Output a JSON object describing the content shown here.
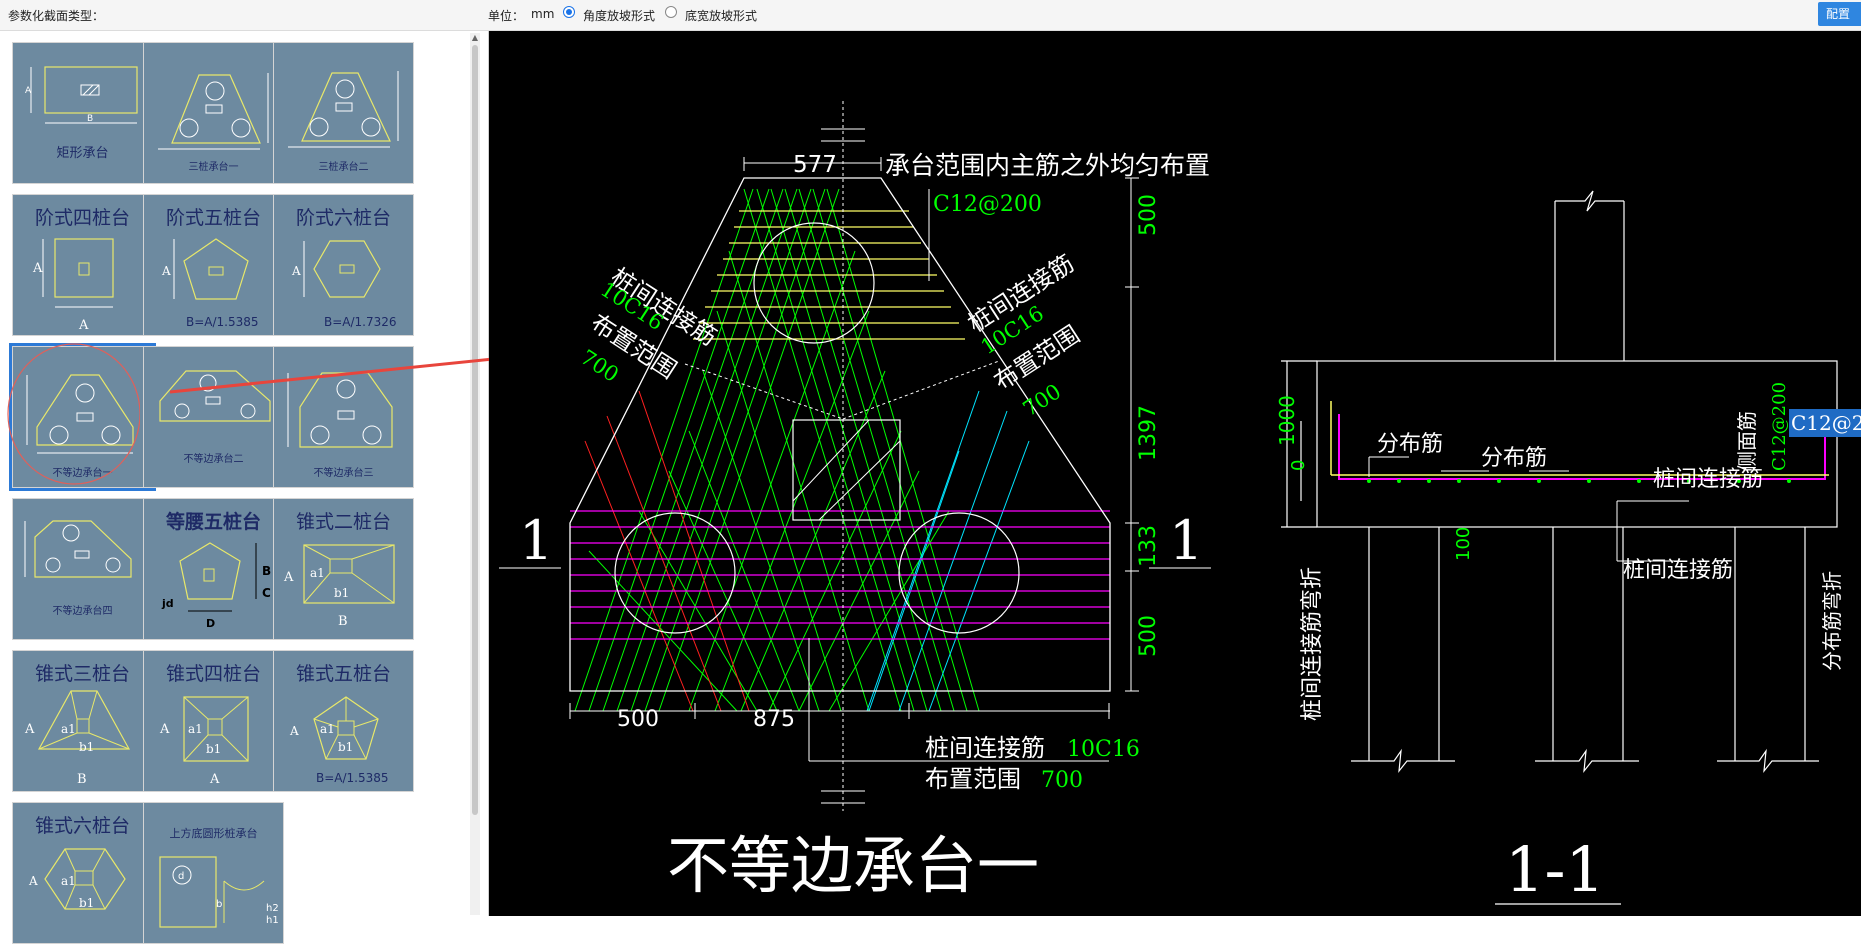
{
  "topbar": {
    "section_label": "参数化截面类型：",
    "unit_label": "单位：",
    "unit_value": "mm",
    "option_angle": "角度放坡形式",
    "option_width": "底宽放坡形式",
    "config_button": "配置"
  },
  "gallery": {
    "tiles": [
      {
        "title": "",
        "caption": "矩形承台"
      },
      {
        "title": "",
        "caption": "三桩承台一"
      },
      {
        "title": "",
        "caption": "三桩承台二"
      },
      {
        "title": "阶式四桩台",
        "caption": ""
      },
      {
        "title": "阶式五桩台",
        "caption": "B=A/1.5385"
      },
      {
        "title": "阶式六桩台",
        "caption": "B=A/1.7326"
      },
      {
        "title": "",
        "caption": "不等边承台一"
      },
      {
        "title": "",
        "caption": "不等边承台二"
      },
      {
        "title": "",
        "caption": "不等边承台三"
      },
      {
        "title": "",
        "caption": "不等边承台四"
      },
      {
        "title": "等腰五桩台",
        "caption": ""
      },
      {
        "title": "锥式二桩台",
        "caption": ""
      },
      {
        "title": "锥式三桩台",
        "caption": ""
      },
      {
        "title": "锥式四桩台",
        "caption": ""
      },
      {
        "title": "锥式五桩台",
        "caption": "B=A/1.5385"
      },
      {
        "title": "锥式六桩台",
        "caption": ""
      },
      {
        "title": "",
        "caption": "上方底圆形桩承台"
      }
    ]
  },
  "drawing": {
    "title_plan": "不等边承台一",
    "title_section": "1-1",
    "section_mark": "1",
    "note_main": "承台范围内主筋之外均匀布置",
    "rebar_c12": "C12@200",
    "conn_label": "桩间连接筋",
    "conn_bar": "10C16",
    "range_label": "布置范围",
    "range_value": "700",
    "dim_577": "577",
    "dim_500": "500",
    "dim_875": "875",
    "dim_1397": "1397",
    "dim_133": "133",
    "dim_1000": "1000",
    "dim_0": "0",
    "dim_100": "100",
    "dist_bar": "分布筋",
    "side_bar": "侧面筋",
    "conn_bend": "桩间连接筋弯折",
    "dist_bend": "分布筋弯折"
  },
  "colors": {
    "accent": "#2d7ad6",
    "tile_bg": "#6d8aa0",
    "tile_line": "#e8e86a",
    "cad_green": "#00ff00",
    "cad_yellow": "#ffff66",
    "cad_magenta": "#ff00ff",
    "cad_red": "#ff2020",
    "cad_cyan": "#00e5ff"
  }
}
